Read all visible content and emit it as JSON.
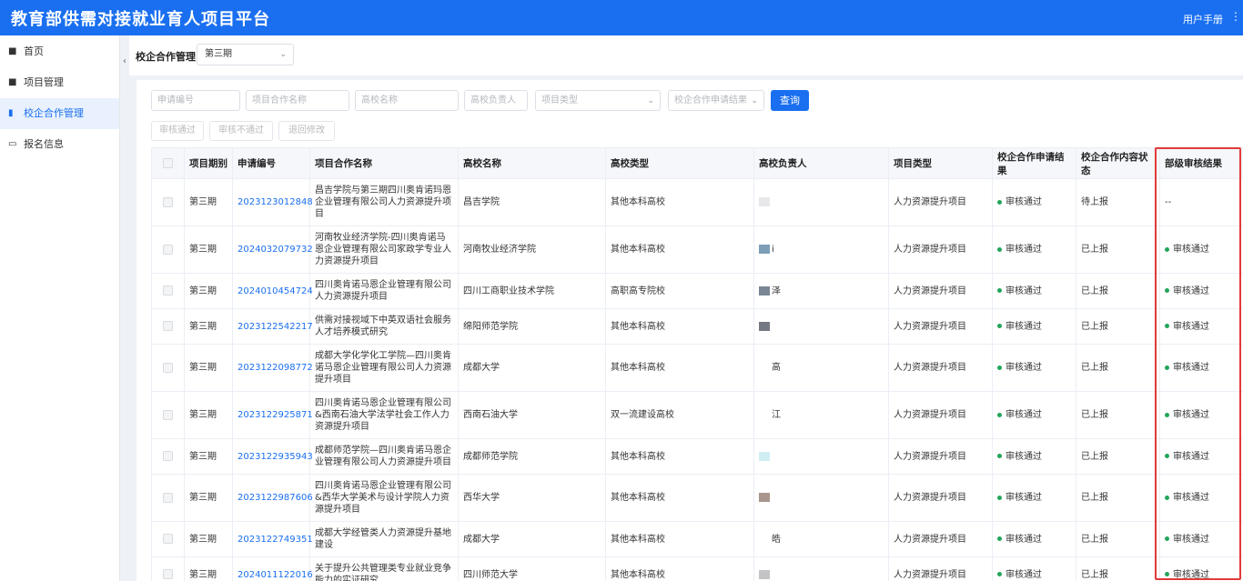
{
  "header": {
    "title": "教育部供需对接就业育人项目平台",
    "manual": "用户手册"
  },
  "sidebar": {
    "items": [
      {
        "label": "首页",
        "icon": "home-icon"
      },
      {
        "label": "项目管理",
        "icon": "square-icon"
      },
      {
        "label": "校企合作管理",
        "icon": "document-icon",
        "active": true
      },
      {
        "label": "报名信息",
        "icon": "card-icon"
      }
    ]
  },
  "subbar": {
    "label": "校企合作管理",
    "period": "第三期"
  },
  "filters": {
    "apply_no": "申请编号",
    "coop_name": "项目合作名称",
    "school_name": "高校名称",
    "school_leader": "高校负责人",
    "project_type": "项目类型",
    "apply_result": "校企合作申请结果",
    "query": "查询"
  },
  "actions": {
    "approve": "审核通过",
    "reject": "审核不通过",
    "return": "退回修改"
  },
  "table": {
    "headers": [
      "项目期别",
      "申请编号",
      "项目合作名称",
      "高校名称",
      "高校类型",
      "高校负责人",
      "项目类型",
      "校企合作申请结果",
      "校企合作内容状态",
      "部级审核结果"
    ],
    "rows": [
      {
        "period": "第三期",
        "code": "2023123012848",
        "name": "昌吉学院与第三期四川奥肯诺玛恩企业管理有限公司人力资源提升项目",
        "school": "昌吉学院",
        "type": "其他本科高校",
        "leader": "",
        "leader_color": "#e8e8ea",
        "ptype": "人力资源提升项目",
        "result": "审核通过",
        "status": "待上报",
        "ministry": "--"
      },
      {
        "period": "第三期",
        "code": "2024032079732",
        "name": "河南牧业经济学院-四川奥肯诺马恩企业管理有限公司家政学专业人力资源提升项目",
        "school": "河南牧业经济学院",
        "type": "其他本科高校",
        "leader": "i",
        "leader_color": "#7c9eb6",
        "ptype": "人力资源提升项目",
        "result": "审核通过",
        "status": "已上报",
        "ministry": "审核通过"
      },
      {
        "period": "第三期",
        "code": "2024010454724",
        "name": "四川奥肯诺马恩企业管理有限公司人力资源提升项目",
        "school": "四川工商职业技术学院",
        "type": "高职高专院校",
        "leader": "泽",
        "leader_color": "#7a8694",
        "ptype": "人力资源提升项目",
        "result": "审核通过",
        "status": "已上报",
        "ministry": "审核通过"
      },
      {
        "period": "第三期",
        "code": "2023122542217",
        "name": "供需对接视域下中英双语社会服务人才培养模式研究",
        "school": "绵阳师范学院",
        "type": "其他本科高校",
        "leader": "",
        "leader_color": "#757984",
        "ptype": "人力资源提升项目",
        "result": "审核通过",
        "status": "已上报",
        "ministry": "审核通过"
      },
      {
        "period": "第三期",
        "code": "2023122098772",
        "name": "成都大学化学化工学院—四川奥肯诺马恩企业管理有限公司人力资源提升项目",
        "school": "成都大学",
        "type": "其他本科高校",
        "leader": "高",
        "leader_color": "#ffffff",
        "ptype": "人力资源提升项目",
        "result": "审核通过",
        "status": "已上报",
        "ministry": "审核通过"
      },
      {
        "period": "第三期",
        "code": "2023122925871",
        "name": "四川奥肯诺马恩企业管理有限公司&西南石油大学法学社会工作人力资源提升项目",
        "school": "西南石油大学",
        "type": "双一流建设高校",
        "leader": "江",
        "leader_color": "#ffffff",
        "ptype": "人力资源提升项目",
        "result": "审核通过",
        "status": "已上报",
        "ministry": "审核通过"
      },
      {
        "period": "第三期",
        "code": "2023122935943",
        "name": "成都师范学院—四川奥肯诺马恩企业管理有限公司人力资源提升项目",
        "school": "成都师范学院",
        "type": "其他本科高校",
        "leader": "",
        "leader_color": "#cfeef4",
        "ptype": "人力资源提升项目",
        "result": "审核通过",
        "status": "已上报",
        "ministry": "审核通过"
      },
      {
        "period": "第三期",
        "code": "2023122987606",
        "name": "四川奥肯诺马恩企业管理有限公司&西华大学美术与设计学院人力资源提升项目",
        "school": "西华大学",
        "type": "其他本科高校",
        "leader": "",
        "leader_color": "#a8968c",
        "ptype": "人力资源提升项目",
        "result": "审核通过",
        "status": "已上报",
        "ministry": "审核通过"
      },
      {
        "period": "第三期",
        "code": "2023122749351",
        "name": "成都大学经管类人力资源提升基地建设",
        "school": "成都大学",
        "type": "其他本科高校",
        "leader": "皓",
        "leader_color": "#ffffff",
        "ptype": "人力资源提升项目",
        "result": "审核通过",
        "status": "已上报",
        "ministry": "审核通过"
      },
      {
        "period": "第三期",
        "code": "2024011122016",
        "name": "关于提升公共管理类专业就业竞争能力的实证研究",
        "school": "四川师范大学",
        "type": "其他本科高校",
        "leader": "",
        "leader_color": "#c4c4c6",
        "ptype": "人力资源提升项目",
        "result": "审核通过",
        "status": "已上报",
        "ministry": "审核通过"
      }
    ]
  }
}
